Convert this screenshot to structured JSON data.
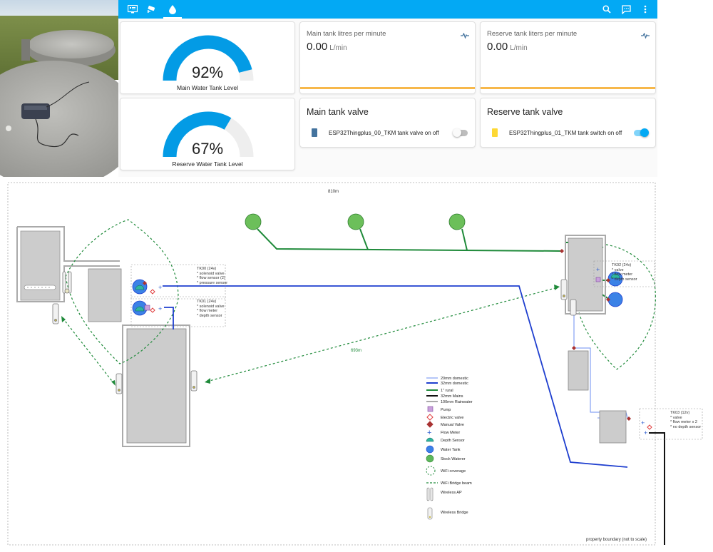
{
  "toolbar": {
    "left_icons": [
      "dashboard-icon",
      "cctv-icon",
      "water-drop-icon"
    ],
    "right_icons": [
      "search-icon",
      "chat-icon",
      "more-vert-icon"
    ],
    "color": "#03a9f4"
  },
  "gauges": [
    {
      "value": "92%",
      "fraction": 0.92,
      "name": "Main Water Tank Level",
      "color": "#039be5"
    },
    {
      "value": "67%",
      "fraction": 0.67,
      "name": "Reserve Water Tank Level",
      "color": "#039be5"
    }
  ],
  "sensors": [
    {
      "title": "Main tank litres per minute",
      "value": "0.00",
      "unit": "L/min",
      "icon": "pulse-icon"
    },
    {
      "title": "Reserve tank liters per minute",
      "value": "0.00",
      "unit": "L/min",
      "icon": "pulse-icon"
    }
  ],
  "valves": [
    {
      "title": "Main tank valve",
      "entity": "ESP32Thingplus_00_TKM tank valve on off",
      "icon": "device-icon",
      "icon_color": "#44739e",
      "state": "off"
    },
    {
      "title": "Reserve tank valve",
      "entity": "ESP32Thingplus_01_TKM tank switch on off",
      "icon": "device-icon",
      "icon_color": "#fdd835",
      "state": "on"
    }
  ],
  "diagram": {
    "dimension_top": "810m",
    "dimension_link": "693m",
    "boundary_note": "property boundary (not to scale)",
    "annotations": {
      "tk00": "TK00 (24v)\n* solenoid valve\n* flow sensor (2)\n* pressure sensor",
      "tk01": "TK01 (24v)\n* solenoid valve\n* flow meter\n* depth sensor",
      "tk02": "TK02 (24v)\n* valve\n* flow meter\n* depth sensor",
      "tk03": "TK03 (12v)\n* valve\n* flow meter x 2\n* no depth sensor"
    },
    "legend": [
      {
        "label": "20mm domestic",
        "color": "#6b8ef0"
      },
      {
        "label": "32mm domestic",
        "color": "#1f3fcf"
      },
      {
        "label": "1\" rural",
        "color": "#1f8a3a"
      },
      {
        "label": "32mm Mains",
        "color": "#111111"
      },
      {
        "label": "100mm Rainwater",
        "color": "#aaaaaa"
      },
      {
        "label": "Pump",
        "color": "#c9a0dc"
      },
      {
        "label": "Electric valve",
        "color": "#e03c3c"
      },
      {
        "label": "Manual Valve",
        "color": "#a83232"
      },
      {
        "label": "Flow Meter",
        "color": "#2f5fd0"
      },
      {
        "label": "Depth Sensor",
        "color": "#2fb5a0"
      },
      {
        "label": "Water Tank",
        "color": "#3b82e6"
      },
      {
        "label": "Stock Waterer",
        "color": "#5cb85c"
      },
      {
        "label": "WiFi coverage",
        "color": "#1f8a3a"
      },
      {
        "label": "WiFi Bridge beam",
        "color": "#1f8a3a"
      },
      {
        "label": "Wireless AP",
        "color": "#888888"
      },
      {
        "label": "Wireless Bridge",
        "color": "#888888"
      }
    ]
  }
}
